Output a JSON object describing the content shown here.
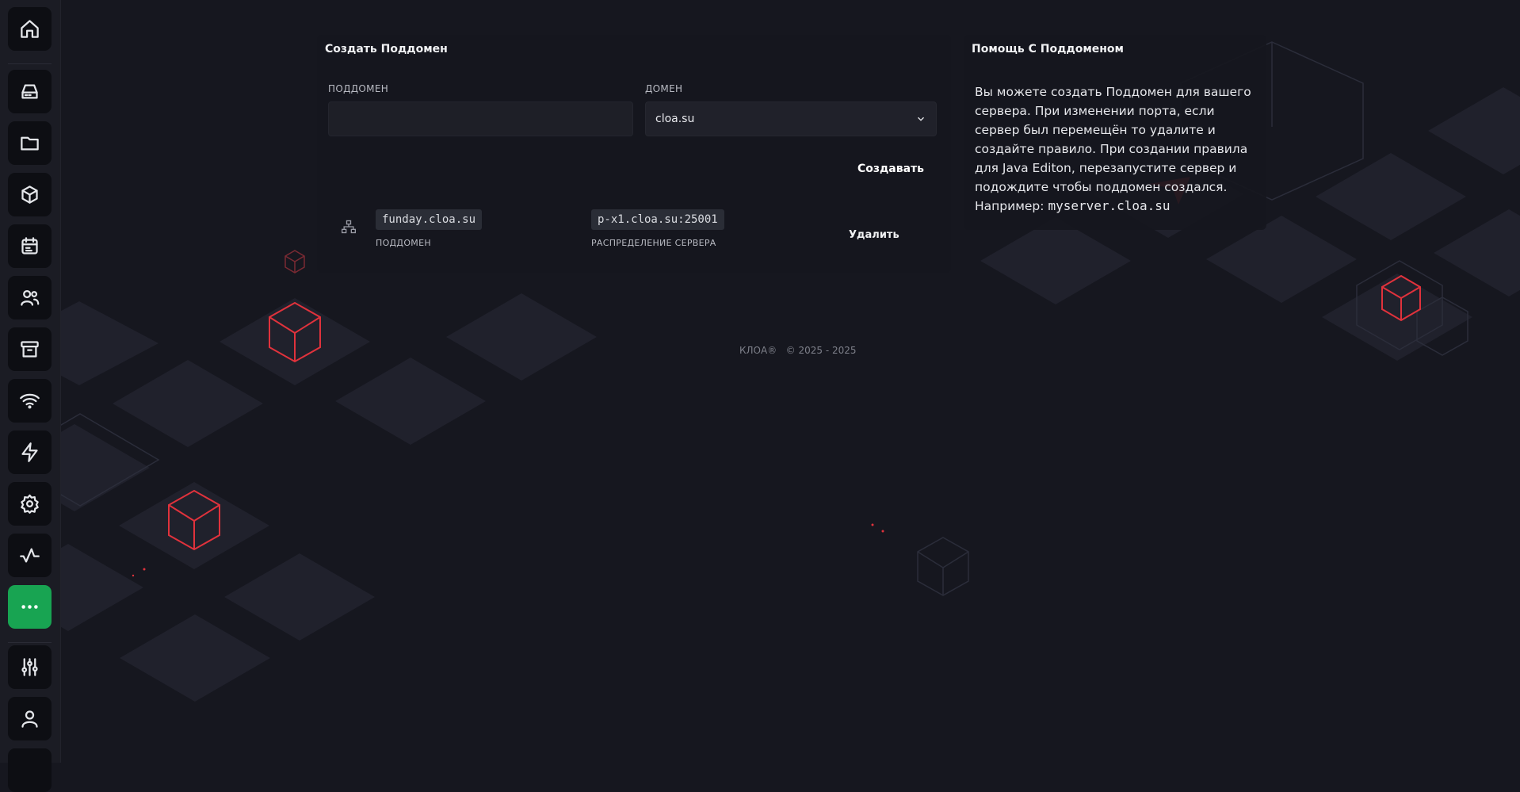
{
  "create_panel": {
    "title": "Создать Поддомен",
    "subdomain_label": "ПОДДОМЕН",
    "subdomain_value": "",
    "domain_label": "ДОМЕН",
    "domain_selected": "cloa.su",
    "create_button": "Создавать"
  },
  "subdomain_row": {
    "icon": "network-icon",
    "subdomain": "funday.cloa.su",
    "subdomain_caption": "ПОДДОМЕН",
    "allocation": "p-x1.cloa.su:25001",
    "allocation_caption": "РАСПРЕДЕЛЕНИЕ СЕРВЕРА",
    "delete_button": "Удалить"
  },
  "help_panel": {
    "title": "Помощь С Поддоменом",
    "text": "Вы можете создать Поддомен для вашего сервера. При изменении порта, если сервер был перемещён то удалите и создайте правило. При создании правила для Java Editon, перезапустите сервер и подождите чтобы поддомен создался. Например:",
    "example": "myserver.cloa.su"
  },
  "footer": {
    "brand": "КЛОА®",
    "copyright": "© 2025 - 2025"
  },
  "sidebar": {
    "items": [
      {
        "icon": "home-icon"
      },
      {
        "icon": "server-icon"
      },
      {
        "icon": "folder-icon"
      },
      {
        "icon": "box-icon"
      },
      {
        "icon": "calendar-icon"
      },
      {
        "icon": "users-icon"
      },
      {
        "icon": "archive-icon"
      },
      {
        "icon": "wifi-icon"
      },
      {
        "icon": "bolt-icon"
      },
      {
        "icon": "gear-icon"
      },
      {
        "icon": "activity-icon"
      },
      {
        "icon": "more-icon",
        "active": true
      },
      {
        "icon": "sliders-icon"
      },
      {
        "icon": "user-icon"
      }
    ]
  },
  "colors": {
    "background": "#16171f",
    "accent": "#18a452",
    "cube_red": "#e0323c"
  }
}
